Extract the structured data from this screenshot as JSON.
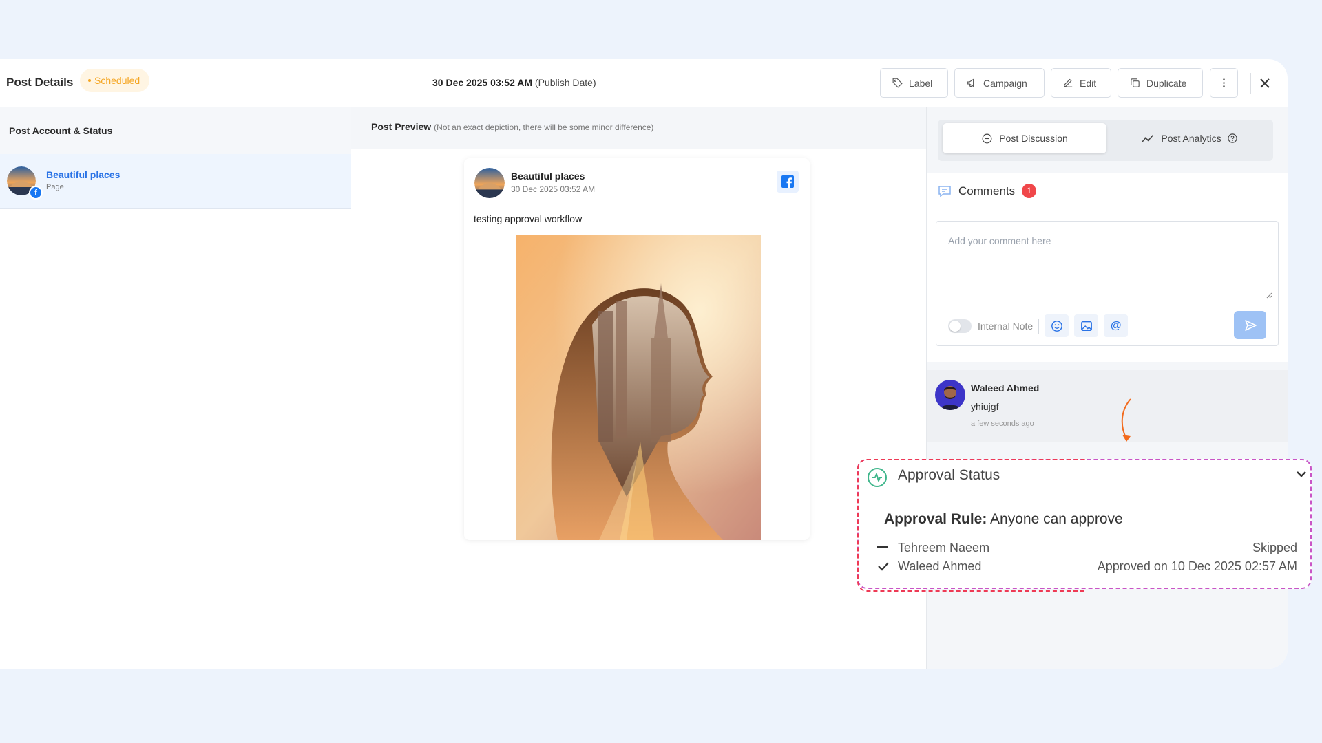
{
  "header": {
    "title": "Post Details",
    "status_badge": "Scheduled",
    "publish_date": "30 Dec 2025 03:52 AM",
    "publish_date_suffix": "(Publish Date)",
    "buttons": {
      "label": "Label",
      "campaign": "Campaign",
      "edit": "Edit",
      "duplicate": "Duplicate"
    }
  },
  "left_panel": {
    "heading": "Post Account & Status",
    "account": {
      "name": "Beautiful places",
      "type": "Page",
      "platform_icon": "facebook-icon"
    }
  },
  "preview": {
    "heading": "Post Preview",
    "note": "(Not an exact depiction, there will be some minor difference)",
    "post": {
      "account_name": "Beautiful places",
      "date": "30 Dec 2025 03:52 AM",
      "text": "testing approval workflow"
    }
  },
  "right_panel": {
    "tabs": {
      "discussion": "Post Discussion",
      "analytics": "Post Analytics"
    },
    "comments": {
      "title": "Comments",
      "count": "1",
      "placeholder": "Add your comment here",
      "internal_note_label": "Internal Note"
    },
    "comment_items": [
      {
        "author": "Waleed Ahmed",
        "text": "yhiujgf",
        "time": "a few seconds ago"
      }
    ]
  },
  "approval": {
    "title": "Approval Status",
    "rule_label": "Approval Rule:",
    "rule_value": "Anyone can approve",
    "approvers": [
      {
        "name": "Tehreem Naeem",
        "status": "Skipped",
        "mark": "dash"
      },
      {
        "name": "Waleed Ahmed",
        "status": "Approved on 10 Dec 2025 02:57 AM",
        "mark": "check"
      }
    ]
  },
  "colors": {
    "page_bg": "#edf3fc",
    "accent_blue": "#2a73e6",
    "scheduled_orange": "#f5a623",
    "badge_red": "#f0474a",
    "callout_red": "#ee3a55",
    "callout_purple": "#c955c6",
    "approval_green": "#3fb68b"
  }
}
